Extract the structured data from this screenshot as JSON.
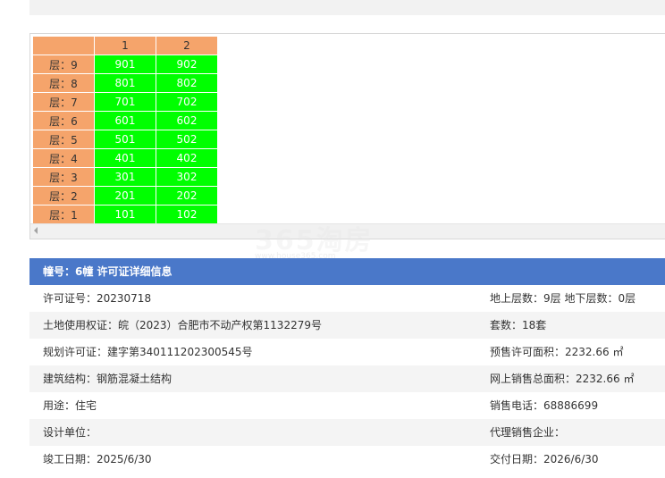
{
  "grid": {
    "columns": [
      "",
      "1",
      "2"
    ],
    "rows": [
      {
        "floor": "层：9",
        "units": [
          "901",
          "902"
        ]
      },
      {
        "floor": "层：8",
        "units": [
          "801",
          "802"
        ]
      },
      {
        "floor": "层：7",
        "units": [
          "701",
          "702"
        ]
      },
      {
        "floor": "层：6",
        "units": [
          "601",
          "602"
        ]
      },
      {
        "floor": "层：5",
        "units": [
          "501",
          "502"
        ]
      },
      {
        "floor": "层：4",
        "units": [
          "401",
          "402"
        ]
      },
      {
        "floor": "层：3",
        "units": [
          "301",
          "302"
        ]
      },
      {
        "floor": "层：2",
        "units": [
          "201",
          "202"
        ]
      },
      {
        "floor": "层：1",
        "units": [
          "101",
          "102"
        ]
      }
    ],
    "colors": {
      "header": "#f5a46b",
      "available": "#00ff00"
    }
  },
  "watermark": {
    "text": "365淘房",
    "url": "www.house365.com"
  },
  "info": {
    "title": "幢号：6幢 许可证详细信息",
    "rows": [
      {
        "left": "许可证号：20230718",
        "right": "地上层数：9层  地下层数：0层"
      },
      {
        "left": "土地使用权证：皖（2023）合肥市不动产权第1132279号",
        "right": "套数：18套"
      },
      {
        "left": "规划许可证：建字第340111202300545号",
        "right": "预售许可面积：2232.66 ㎡"
      },
      {
        "left": "建筑结构：钢筋混凝土结构",
        "right": "网上销售总面积：2232.66 ㎡"
      },
      {
        "left": "用途：住宅",
        "right": "销售电话：68886699"
      },
      {
        "left": "设计单位：",
        "right": "代理销售企业："
      },
      {
        "left": "竣工日期：2025/6/30",
        "right": "交付日期：2026/6/30"
      }
    ]
  }
}
